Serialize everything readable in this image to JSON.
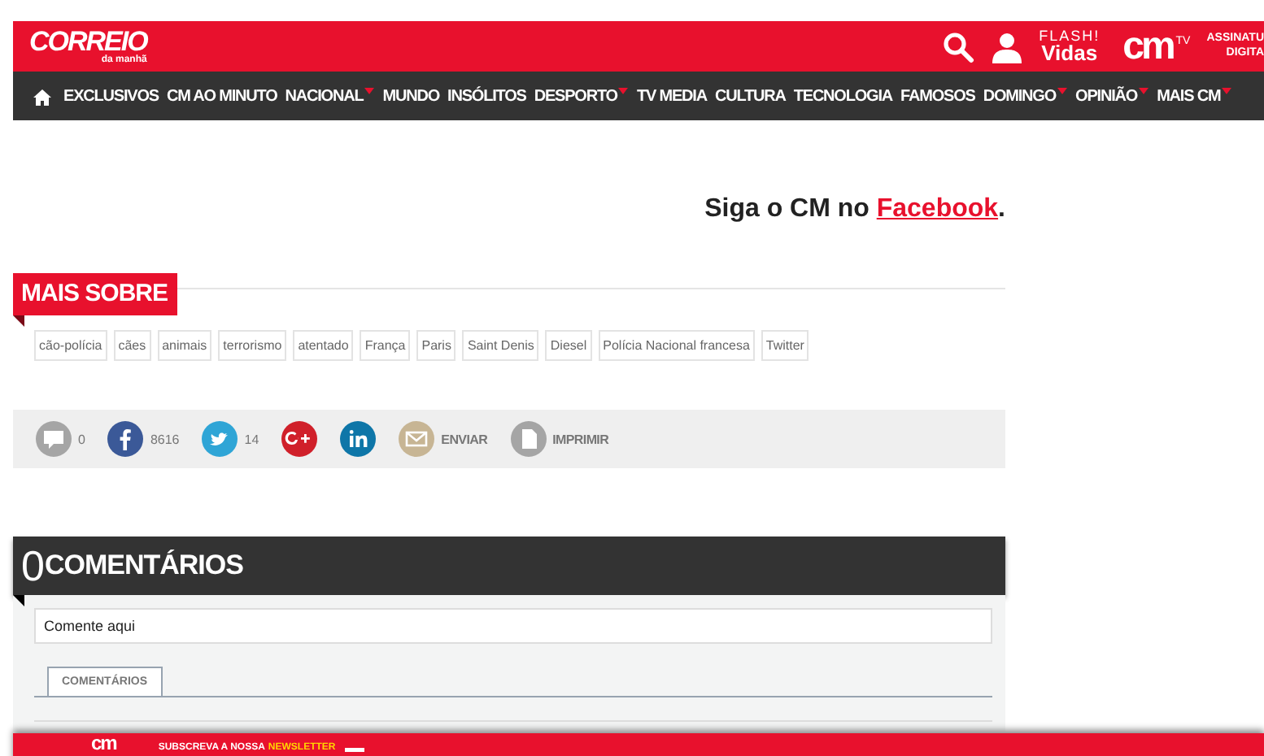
{
  "header": {
    "logo": "CORREIO",
    "logo_sub": "da manhã",
    "flash_top": "FLASH!",
    "flash_bottom": "Vidas",
    "cm_logo": "cm",
    "cm_tv": "TV",
    "subscribe_top": "ASSINATU",
    "subscribe_bottom": "DIGITA"
  },
  "nav": [
    {
      "label": "EXCLUSIVOS",
      "dropdown": false
    },
    {
      "label": "CM AO MINUTO",
      "dropdown": false
    },
    {
      "label": "NACIONAL",
      "dropdown": true
    },
    {
      "label": "MUNDO",
      "dropdown": false
    },
    {
      "label": "INSÓLITOS",
      "dropdown": false
    },
    {
      "label": "DESPORTO",
      "dropdown": true
    },
    {
      "label": "TV MEDIA",
      "dropdown": false
    },
    {
      "label": "CULTURA",
      "dropdown": false
    },
    {
      "label": "TECNOLOGIA",
      "dropdown": false
    },
    {
      "label": "FAMOSOS",
      "dropdown": false
    },
    {
      "label": "DOMINGO",
      "dropdown": true
    },
    {
      "label": "OPINIÃO",
      "dropdown": true
    },
    {
      "label": "MAIS CM",
      "dropdown": true
    }
  ],
  "follow": {
    "text": "Siga o CM no",
    "link": "Facebook",
    "end": "."
  },
  "related": {
    "title": "MAIS SOBRE",
    "tags": [
      "cão-polícia",
      "cães",
      "animais",
      "terrorismo",
      "atentado",
      "França",
      "Paris",
      "Saint Denis",
      "Diesel",
      "Polícia Nacional francesa",
      "Twitter"
    ]
  },
  "share": [
    {
      "kind": "comment",
      "count": "0"
    },
    {
      "kind": "facebook",
      "count": "8616"
    },
    {
      "kind": "twitter",
      "count": "14"
    },
    {
      "kind": "googleplus"
    },
    {
      "kind": "linkedin"
    },
    {
      "kind": "email",
      "label": "ENVIAR"
    },
    {
      "kind": "print",
      "label": "IMPRIMIR"
    }
  ],
  "comments": {
    "count": "0",
    "title": "COMENTÁRIOS",
    "placeholder": "Comente aqui",
    "tabs": [
      {
        "label": "COMENTÁRIOS",
        "selected": true
      }
    ]
  },
  "footer": {
    "logo": "cm",
    "text": "SUBSCREVA A NOSSA",
    "highlight": "NEWSLETTER"
  }
}
